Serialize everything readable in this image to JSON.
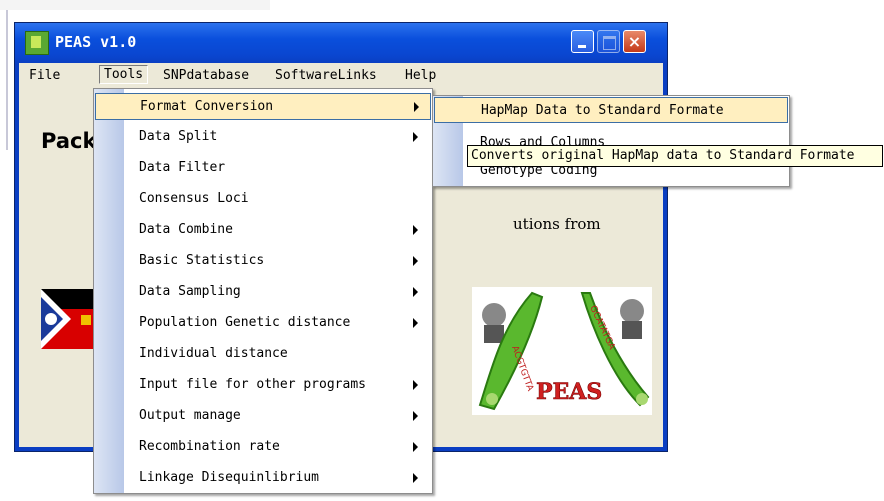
{
  "window": {
    "title": "PEAS v1.0",
    "controls": {
      "minimize": "minimize-button",
      "maximize": "maximize-button",
      "close": "×"
    }
  },
  "menubar": {
    "items": [
      "File",
      "Tools",
      "SNPdatabase",
      "SoftwareLinks",
      "Help"
    ],
    "active": "Tools"
  },
  "client": {
    "heading": "Pack",
    "text": "utions from"
  },
  "tools_menu": {
    "items": [
      {
        "label": "Format Conversion",
        "submenu": true
      },
      {
        "label": "Data Split",
        "submenu": true
      },
      {
        "label": "Data Filter",
        "submenu": false
      },
      {
        "label": "Consensus Loci",
        "submenu": false
      },
      {
        "label": "Data Combine",
        "submenu": true
      },
      {
        "label": "Basic Statistics",
        "submenu": true
      },
      {
        "label": "Data Sampling",
        "submenu": true
      },
      {
        "label": "Population Genetic distance",
        "submenu": true
      },
      {
        "label": "Individual distance",
        "submenu": false
      },
      {
        "label": "Input file for other programs",
        "submenu": true
      },
      {
        "label": "Output manage",
        "submenu": true
      },
      {
        "label": "Recombination rate",
        "submenu": true
      },
      {
        "label": "Linkage Disequinlibrium",
        "submenu": true
      }
    ],
    "selected": "Format Conversion"
  },
  "format_submenu": {
    "items": [
      "HapMap Data to Standard Formate",
      "Rows and Columns",
      "Genotype Coding"
    ],
    "selected": "HapMap Data to Standard Formate"
  },
  "tooltip": "Converts original HapMap data to Standard Formate",
  "logo": {
    "text": "PEAS",
    "left_pod": "ACGTGTTA",
    "right_pod": "GCATATGA"
  },
  "colors": {
    "titlebar": "#0a4fdc",
    "menu_highlight": "#ffefc0",
    "menu_border": "#3b6ea5",
    "face": "#ece9d8"
  }
}
